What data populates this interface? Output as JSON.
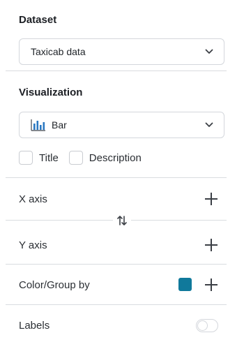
{
  "dataset": {
    "title": "Dataset",
    "selected": "Taxicab data"
  },
  "visualization": {
    "title": "Visualization",
    "selected": "Bar",
    "icon": "bar-chart-icon",
    "options": {
      "title_label": "Title",
      "title_checked": false,
      "description_label": "Description",
      "description_checked": false
    }
  },
  "axes": {
    "x_label": "X axis",
    "y_label": "Y axis",
    "swap_icon": "swap-arrows-icon"
  },
  "color_group": {
    "label": "Color/Group by",
    "swatch_color": "#10799b"
  },
  "labels": {
    "label": "Labels",
    "enabled": false
  },
  "colors": {
    "accent": "#10799b",
    "bar_icon": "#2b78c2"
  }
}
